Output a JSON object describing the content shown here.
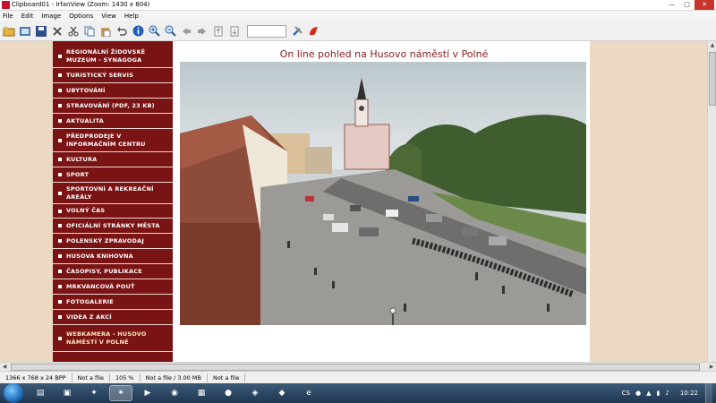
{
  "window": {
    "title": "Clipboard01 - IrfanView (Zoom: 1430 x 804)",
    "buttons": {
      "minimize": "—",
      "maximize": "□",
      "close": "✕"
    }
  },
  "menu": [
    "File",
    "Edit",
    "Image",
    "Options",
    "View",
    "Help"
  ],
  "toolbar": {
    "icons": [
      "open-icon",
      "thumbnails-icon",
      "save-icon",
      "delete-icon",
      "cut-icon",
      "copy-icon",
      "paste-icon",
      "undo-icon",
      "info-icon",
      "zoom-in-icon",
      "zoom-out-icon",
      "prev-icon",
      "next-icon",
      "first-page-icon",
      "last-page-icon",
      "settings-icon",
      "irfanview-logo-icon"
    ],
    "search_value": ""
  },
  "webpage": {
    "heading": "On line pohled na Husovo náměstí v Polné",
    "nav": [
      "REGIONÁLNÍ ŽIDOVSKÉ MUZEUM - SYNAGOGA",
      "TURISTICKÝ SERVIS",
      "UBYTOVÁNÍ",
      "STRAVOVÁNÍ (PDF, 23 KB)",
      "AKTUALITA",
      "PŘEDPRODEJE V INFORMAČNÍM CENTRU",
      "KULTURA",
      "SPORT",
      "SPORTOVNÍ A REKREAČNÍ AREÁLY",
      "VOLNÝ ČAS",
      "OFICIÁLNÍ STRÁNKY MĚSTA",
      "POLENSKÝ ZPRAVODAJ",
      "HUSOVA KNIHOVNA",
      "ČASOPISY, PUBLIKACE",
      "MRKVANCOVÁ POUŤ",
      "FOTOGALERIE",
      "VIDEA Z AKCÍ",
      "WEBKAMERA - HUSOVO NÁMĚSTÍ V POLNÉ"
    ]
  },
  "status": [
    "1366 x 768 x 24 BPP",
    "Not a file",
    "105 %",
    "Not a file / 3.00 MB",
    "Not a file"
  ],
  "taskbar": {
    "tray_lang": "CS",
    "clock": "10:22"
  },
  "colors": {
    "nav_bg": "#7a1414",
    "heading": "#8b1a1a",
    "viewer_bg": "#ecd9c3"
  }
}
